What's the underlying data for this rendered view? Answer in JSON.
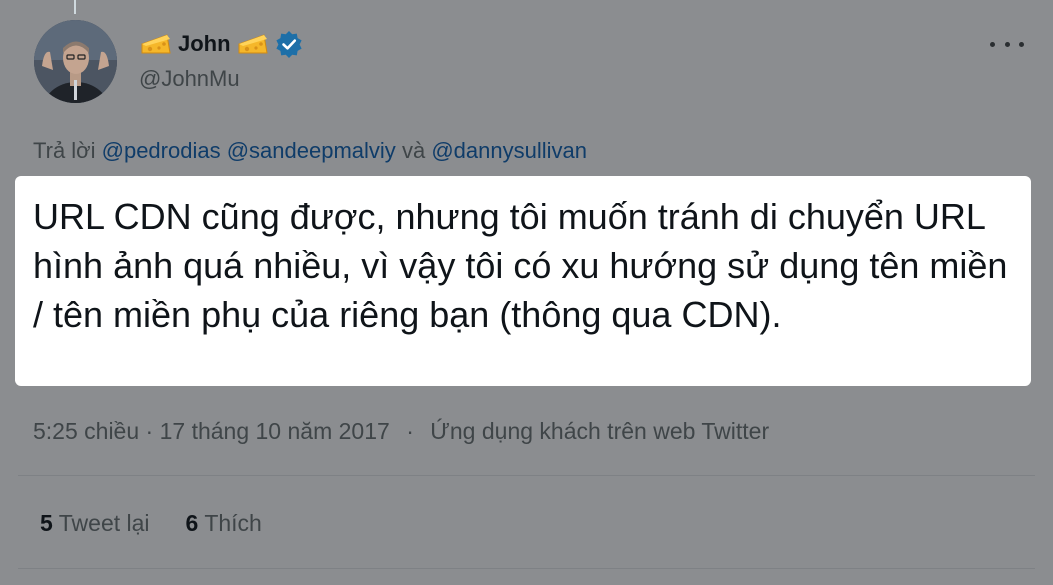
{
  "author": {
    "display_name": "John",
    "handle": "@JohnMu",
    "verified": true,
    "name_emoji": "cheese-wedge-icon",
    "avatar": "avatar-photo"
  },
  "reply": {
    "prefix": "Trả lời",
    "mention_1": "@pedrodias",
    "mention_2": "@sandeepmalviy",
    "conjunction": "và",
    "mention_3": "@dannysullivan"
  },
  "tweet": {
    "text": "URL CDN cũng được, nhưng tôi muốn tránh di chuyển URL hình ảnh quá nhiều, vì vậy tôi có xu hướng sử dụng tên miền / tên miền phụ của riêng bạn (thông qua CDN)."
  },
  "meta": {
    "time": "5:25 chiều",
    "separator": "·",
    "date": "17 tháng 10 năm 2017",
    "source": "Ứng dụng khách trên web Twitter"
  },
  "stats": {
    "retweet_count": "5",
    "retweet_label": "Tweet lại",
    "like_count": "6",
    "like_label": "Thích"
  },
  "icons": {
    "more": "more-horizontal-icon",
    "verified": "verified-badge-icon"
  },
  "colors": {
    "overlay_background": "#8b8d90",
    "tweet_highlight": "#ffffff",
    "verified_blue": "#1d9bf0",
    "mention": "#0f3c69"
  }
}
